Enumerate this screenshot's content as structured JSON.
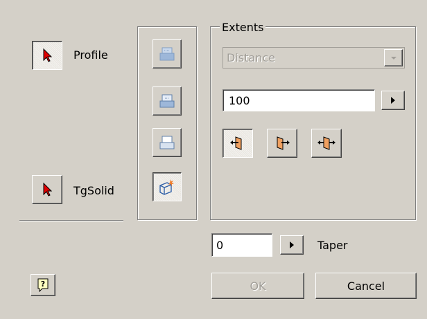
{
  "selection": {
    "profile_label": "Profile",
    "tgsolid_label": "TgSolid"
  },
  "extents": {
    "group_title": "Extents",
    "type_selected": "Distance",
    "distance_value": "100"
  },
  "taper": {
    "value": "0",
    "label": "Taper"
  },
  "buttons": {
    "ok_label": "OK",
    "cancel_label": "Cancel"
  },
  "colors": {
    "dialog_bg": "#d4d0c8",
    "pointer_red": "#e00000",
    "direction_orange": "#f0a060",
    "disabled_text": "#a19e98"
  }
}
